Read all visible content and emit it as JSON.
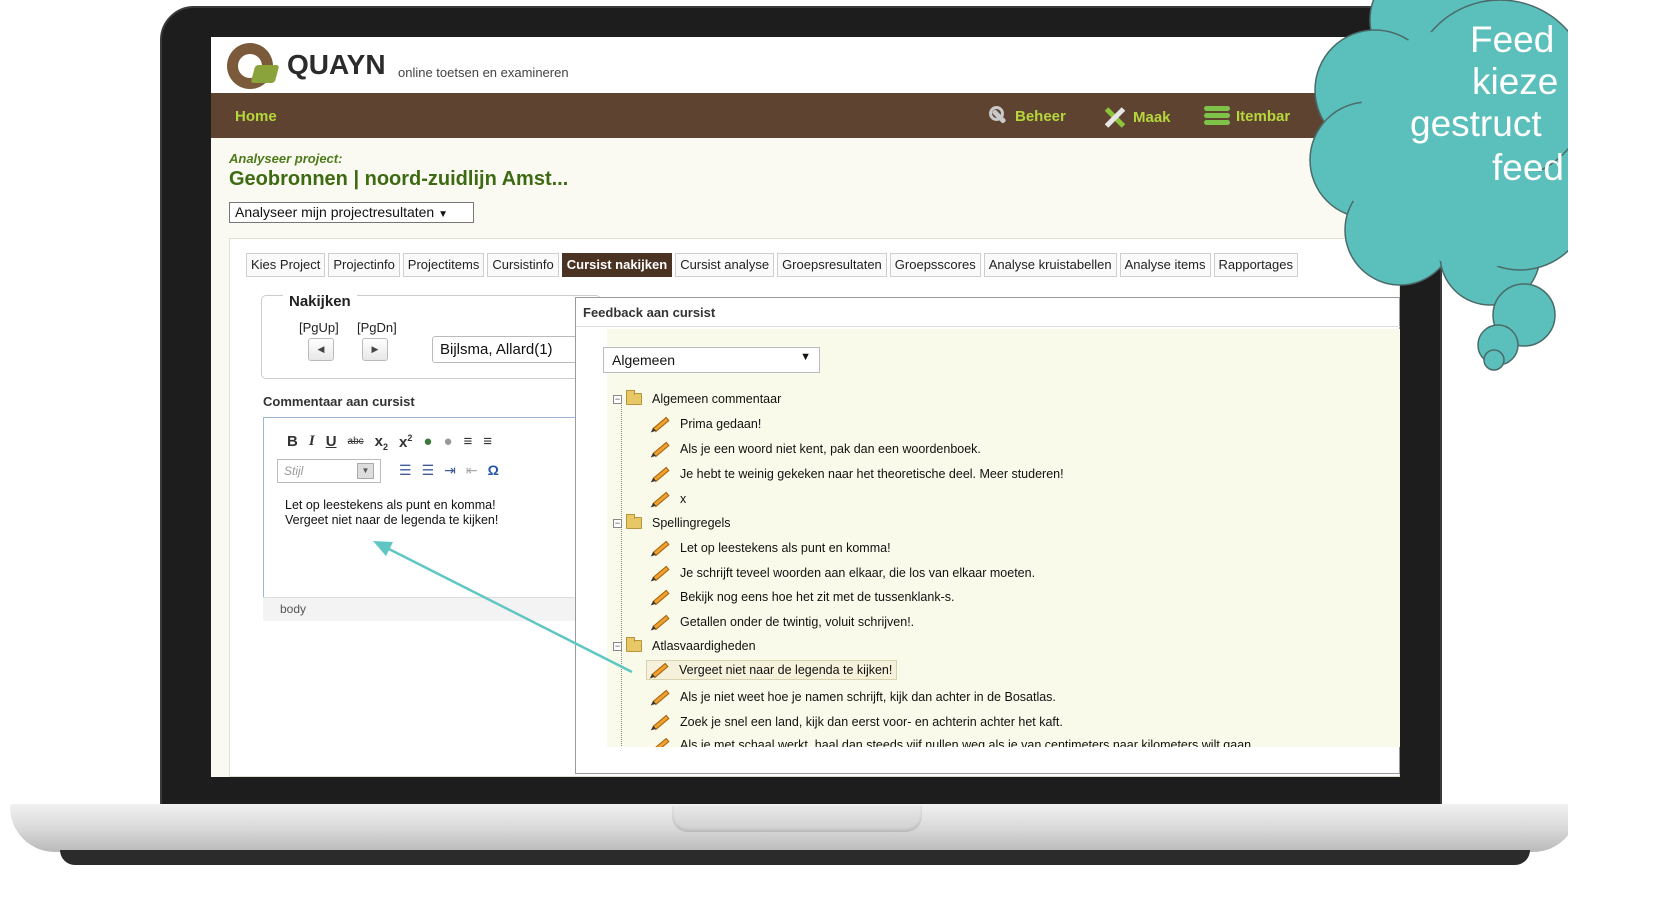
{
  "brand": {
    "wordmark": "QUAYN",
    "tagline": "online toetsen en examineren"
  },
  "nav": {
    "home": "Home",
    "beheer": "Beheer",
    "maak": "Maak",
    "itembank": "Itembar"
  },
  "project": {
    "label": "Analyseer project:",
    "title": "Geobronnen | noord-zuidlijn Amst...",
    "select": "Analyseer mijn projectresultaten"
  },
  "tabs": [
    "Kies Project",
    "Projectinfo",
    "Projectitems",
    "Cursistinfo",
    "Cursist nakijken",
    "Cursist analyse",
    "Groepsresultaten",
    "Groepsscores",
    "Analyse kruistabellen",
    "Analyse items",
    "Rapportages"
  ],
  "nakijken": {
    "legend": "Nakijken",
    "pgup": "[PgUp]",
    "pgdn": "[PgDn]",
    "student": "Bijlsma, Allard(1)"
  },
  "editor": {
    "label": "Commentaar aan cursist",
    "style_placeholder": "Stijl",
    "lines": [
      "Let op leestekens als punt en komma!",
      "Vergeet niet naar de legenda te kijken!"
    ],
    "status": "body"
  },
  "feedback": {
    "title": "Feedback aan cursist",
    "category": "Algemeen",
    "groups": [
      {
        "name": "Algemeen commentaar",
        "items": [
          "Prima gedaan!",
          "Als je een woord niet kent, pak dan een woordenboek.",
          "Je hebt te weinig gekeken naar het theoretische deel. Meer studeren!",
          "x"
        ]
      },
      {
        "name": "Spellingregels",
        "items": [
          "Let op leestekens als punt en komma!",
          "Je schrijft teveel woorden aan elkaar, die los van elkaar moeten.",
          "Bekijk nog eens hoe het zit met de tussenklank-s.",
          "Getallen onder de twintig, voluit schrijven!."
        ]
      },
      {
        "name": "Atlasvaardigheden",
        "items": [
          "Vergeet niet naar de legenda te kijken!",
          "Als je niet weet hoe je namen schrijft, kijk dan achter in de Bosatlas.",
          "Zoek je snel een land, kijk dan eerst voor- en achterin achter het kaft.",
          "Als je met schaal werkt, haal dan steeds vijf nullen weg als je van centimeters naar kilometers wilt gaan"
        ]
      }
    ]
  },
  "cloud": {
    "lines": [
      "Feed",
      "kieze",
      "gestruct",
      "feed"
    ],
    "color": "#5bbfbc"
  },
  "colors": {
    "navbar": "#5f4331",
    "nav_text": "#b5d63c",
    "title_green": "#3d6a12",
    "arrow": "#5fc6c4"
  }
}
